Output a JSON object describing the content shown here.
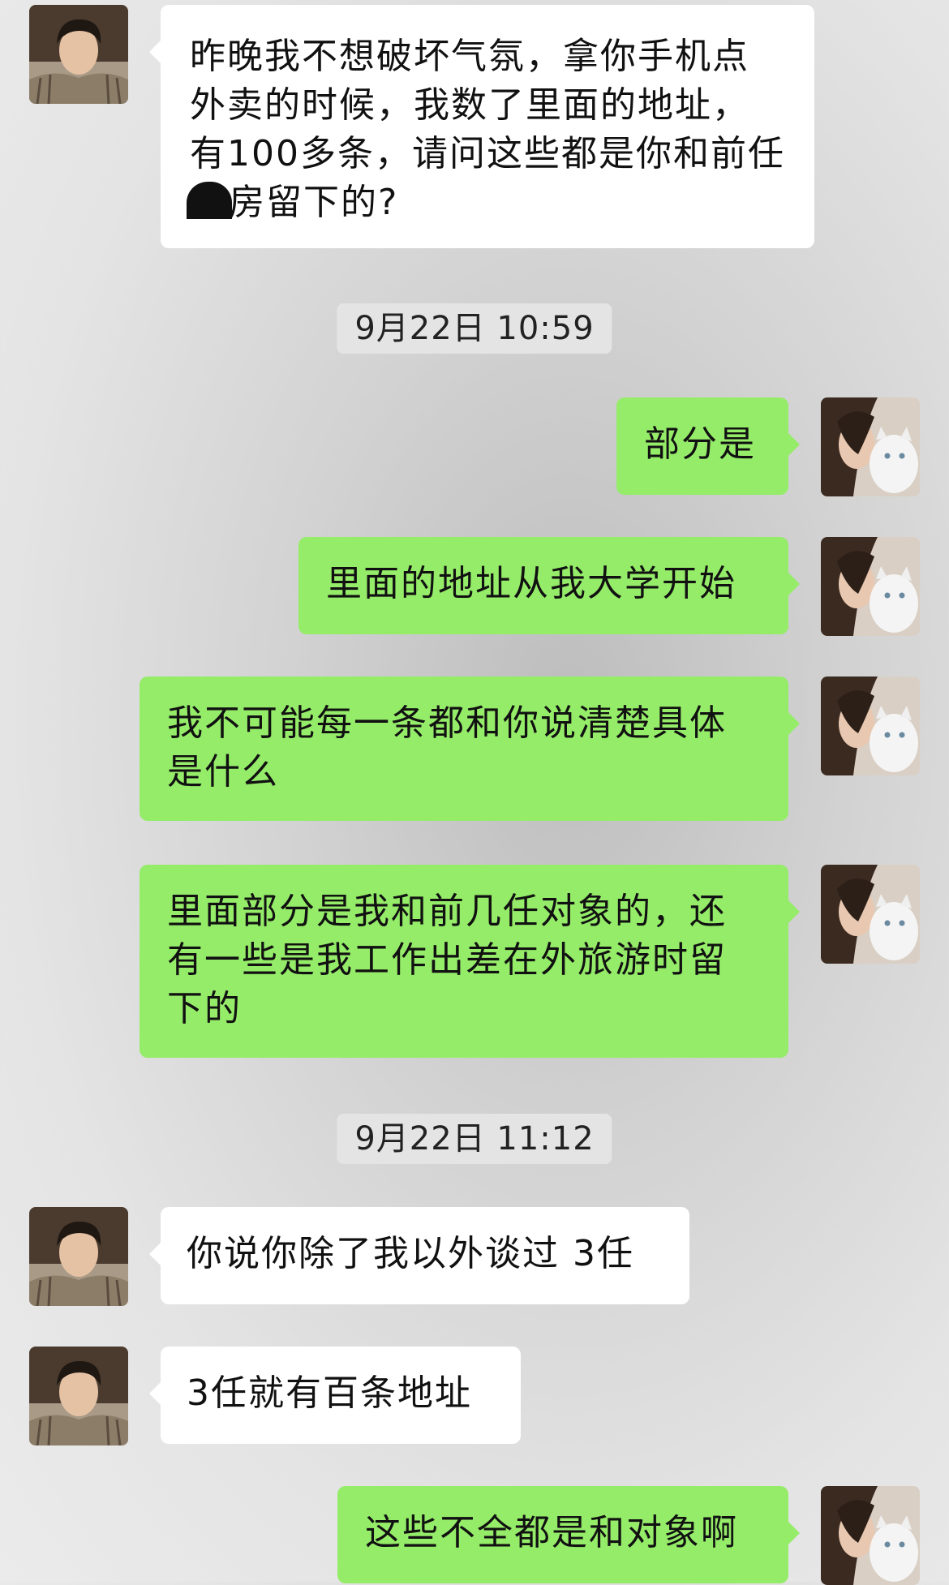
{
  "messages": [
    {
      "side": "in",
      "text": "昨晚我不想破坏气氛，拿你手机点外卖的时候，我数了里面的地址，有100多条，请问这些都是你和前任"
    },
    {
      "side": "in",
      "text_suffix": "房留下的?"
    },
    {
      "timestamp": "9月22日 10:59"
    },
    {
      "side": "out",
      "text": "部分是"
    },
    {
      "side": "out",
      "text": "里面的地址从我大学开始"
    },
    {
      "side": "out",
      "text": "我不可能每一条都和你说清楚具体是什么"
    },
    {
      "side": "out",
      "text": "里面部分是我和前几任对象的，还有一些是我工作出差在外旅游时留下的"
    },
    {
      "timestamp": "9月22日 11:12"
    },
    {
      "side": "in",
      "text": "你说你除了我以外谈过 3任"
    },
    {
      "side": "in",
      "text": "3任就有百条地址"
    },
    {
      "side": "out",
      "text": "这些不全都是和对象啊"
    }
  ],
  "colors": {
    "incoming_bubble": "#ffffff",
    "outgoing_bubble": "#95ec69"
  },
  "avatars": {
    "incoming": "man-portrait-avatar",
    "outgoing": "woman-with-cat-avatar"
  }
}
